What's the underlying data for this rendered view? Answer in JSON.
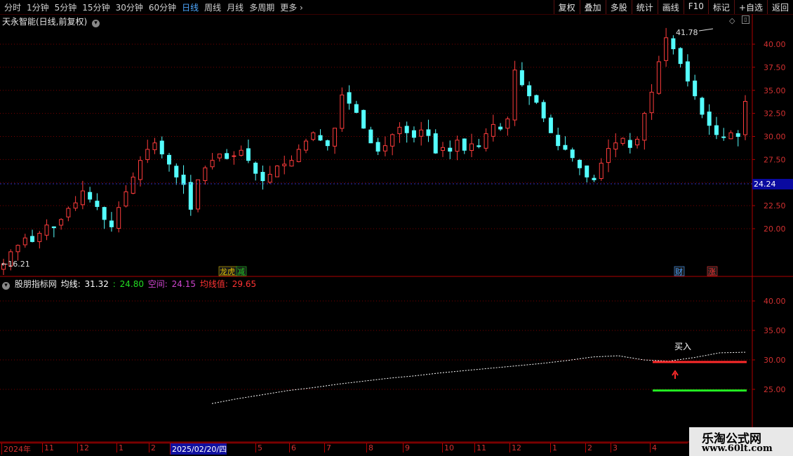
{
  "toolbar": {
    "periods": [
      "分时",
      "1分钟",
      "5分钟",
      "15分钟",
      "30分钟",
      "60分钟",
      "日线",
      "周线",
      "月线",
      "多周期",
      "更多"
    ],
    "active_period": "日线",
    "more_arrow": "›",
    "right_buttons": [
      "复权",
      "叠加",
      "多股",
      "统计",
      "画线",
      "F10",
      "标记",
      "+自选",
      "返回"
    ]
  },
  "main_panel": {
    "title": "天永智能(日线,前复权)",
    "high_label": "41.78",
    "low_label": "16.21",
    "current_price_tag": "24.24",
    "signals": [
      {
        "text": "龙虎",
        "color": "#e0c000"
      },
      {
        "text": "减",
        "color": "#22cc22"
      },
      {
        "text": "财",
        "color": "#4aa0ff"
      },
      {
        "text": "涨",
        "color": "#ff3333"
      }
    ]
  },
  "indicator_panel": {
    "name": "股朋指标网",
    "avg_label": "均线:",
    "avg_value": "31.32",
    "val2_prefix": ":",
    "val2": "24.80",
    "kong_label": "空间:",
    "kong_value": "24.15",
    "jx_label": "均线值:",
    "jx_value": "29.65",
    "buy_label": "买入",
    "colors": {
      "avg": "#ffffff",
      "green": "#22dd22",
      "kong": "#cc44cc",
      "jx": "#ff3333"
    }
  },
  "date_axis": {
    "labels": [
      "2024年",
      "11",
      "12",
      "1",
      "2",
      "2025/02/20/四",
      "5",
      "6",
      "7",
      "8",
      "9",
      "10",
      "11",
      "12",
      "1",
      "2",
      "3",
      "4"
    ],
    "highlighted": "2025/02/20/四"
  },
  "watermark": {
    "line1": "乐淘公式网",
    "line2": "www.60lt.com"
  },
  "chart_data": [
    {
      "type": "line",
      "title": "天永智能(日线,前复权)",
      "note": "candlestick price series (approximate daily path)",
      "y_ticks": [
        20.0,
        22.5,
        25.0,
        27.5,
        30.0,
        32.5,
        35.0,
        37.5,
        40.0
      ],
      "ylim": [
        15.0,
        42.5
      ],
      "annotations": {
        "high": 41.78,
        "low": 16.21,
        "last": 24.24
      },
      "series": [
        {
          "values": [
            16.2,
            17.5,
            18.2,
            19.0,
            18.6,
            19.5,
            20.4,
            20.1,
            21.0,
            22.2,
            22.8,
            24.1,
            23.2,
            22.4,
            21.0,
            20.2,
            22.3,
            24.0,
            25.6,
            27.4,
            28.6,
            29.3,
            28.1,
            27.0,
            25.6,
            24.8,
            22.1,
            25.3,
            26.6,
            27.4,
            28.1,
            27.6,
            27.9,
            28.5,
            27.4,
            26.0,
            25.2,
            25.9,
            26.8,
            27.0,
            27.4,
            28.6,
            29.5,
            30.4,
            29.6,
            29.0,
            30.9,
            34.5,
            33.6,
            32.6,
            30.9,
            29.3,
            28.4,
            29.0,
            30.2,
            31.0,
            30.4,
            29.9,
            30.7,
            30.1,
            28.2,
            28.8,
            28.4,
            29.6,
            28.5,
            29.2,
            28.9,
            30.3,
            31.3,
            30.8,
            31.9,
            37.2,
            35.6,
            34.4,
            33.7,
            32.0,
            30.4,
            29.0,
            28.6,
            27.7,
            26.6,
            25.6,
            25.3,
            27.1,
            28.7,
            29.3,
            29.8,
            28.8,
            29.7,
            32.5,
            34.8,
            38.1,
            40.7,
            39.5,
            37.9,
            36.0,
            34.4,
            32.4,
            31.2,
            30.2,
            29.9,
            30.4,
            30.0,
            33.8
          ]
        }
      ]
    },
    {
      "type": "line",
      "title": "股朋指标网",
      "y_ticks": [
        25.0,
        30.0,
        35.0,
        40.0
      ],
      "ylim": [
        20.0,
        43.0
      ],
      "series": [
        {
          "name": "均线",
          "values": [
            22.6,
            23.4,
            24.1,
            24.8,
            25.3,
            25.9,
            26.4,
            26.9,
            27.3,
            27.8,
            28.2,
            28.6,
            29.0,
            29.4,
            29.9,
            30.5,
            30.7,
            30.0,
            29.8,
            30.4,
            31.2,
            31.3
          ]
        },
        {
          "name": "均线值",
          "values": [
            29.65,
            29.65
          ]
        },
        {
          "name": "空间",
          "values": [
            24.8,
            24.8
          ]
        }
      ]
    }
  ]
}
